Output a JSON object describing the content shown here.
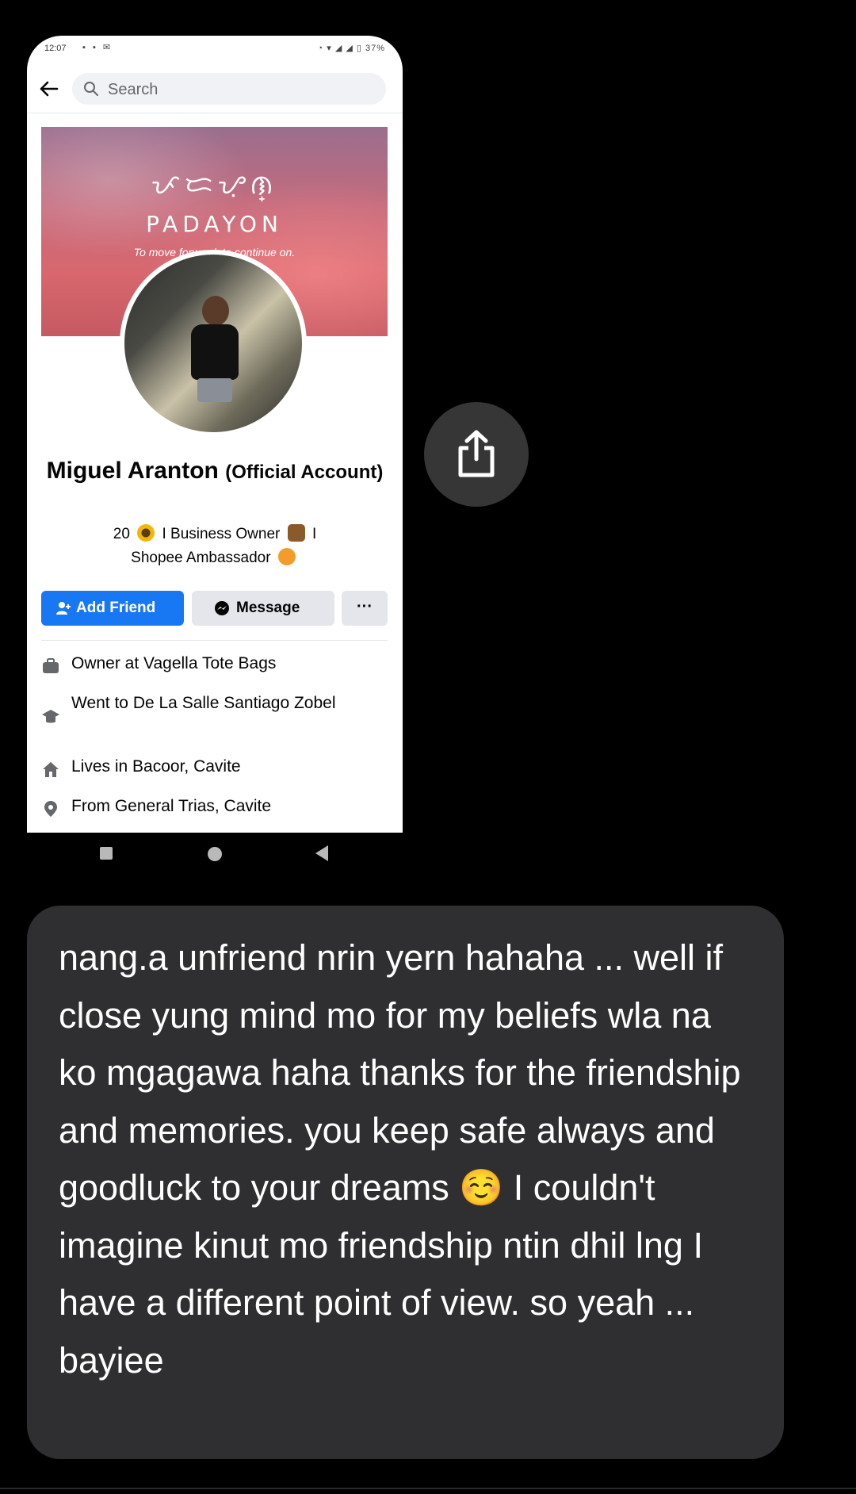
{
  "status_bar": {
    "time": "12:07",
    "left_icons": "▪ ▪ ✉",
    "battery": "37%"
  },
  "search": {
    "placeholder": "Search"
  },
  "cover": {
    "script_text": "ᜉᜇᜌᜓᜈ᜔",
    "title": "PADAYON",
    "tagline": "To move forward, to continue on."
  },
  "profile": {
    "name": "Miguel Aranton",
    "name_suffix": "(Official Account)",
    "bio_line1_prefix": "20",
    "bio_line1_mid": "I Business Owner",
    "bio_line1_end": "I",
    "bio_line2": "Shopee Ambassador"
  },
  "actions": {
    "add_friend": "Add Friend",
    "message": "Message",
    "more": "···"
  },
  "details": [
    {
      "icon": "briefcase-icon",
      "text": "Owner at Vagella Tote Bags"
    },
    {
      "icon": "graduation-cap-icon",
      "text": "Went to De La Salle Santiago Zobel"
    },
    {
      "icon": "home-icon",
      "text": "Lives in Bacoor, Cavite"
    },
    {
      "icon": "location-pin-icon",
      "text": "From General Trias, Cavite"
    }
  ],
  "message_bubble": {
    "text": "nang.a unfriend nrin yern hahaha ... well if close yung mind mo for my beliefs wla na ko mgagawa haha thanks for the friendship and memories. you keep safe always and goodluck to your dreams ☺️ I couldn't imagine kinut mo friendship ntin dhil lng I have a different point of view. so yeah ... bayiee"
  },
  "colors": {
    "facebook_blue": "#1877f2",
    "bubble_bg": "#2f2f31",
    "background": "#000000"
  }
}
